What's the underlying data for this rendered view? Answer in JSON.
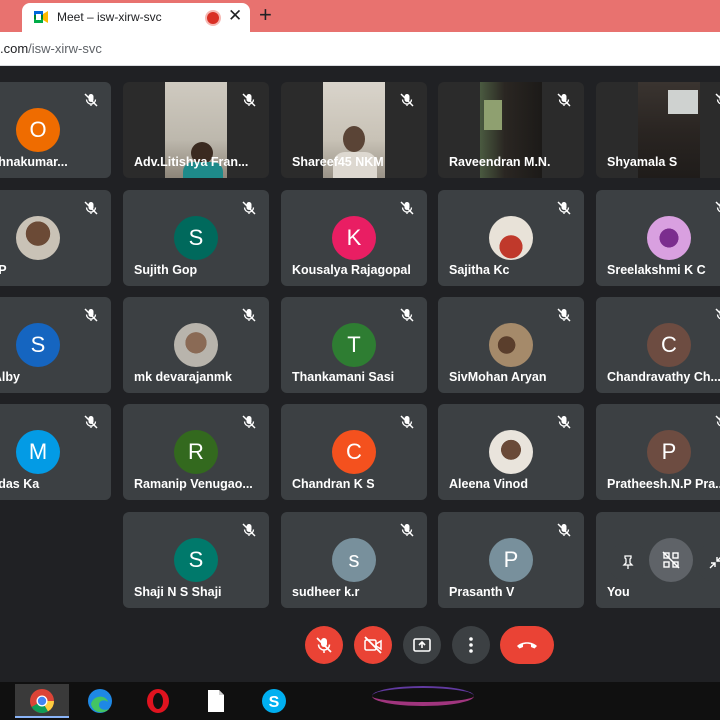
{
  "browser": {
    "tab_title": "Meet – isw-xirw-svc",
    "url_host": ".com",
    "url_path": "/isw-xirw-svc"
  },
  "participants": [
    {
      "name": "krishnakumar...",
      "initial": "O",
      "color": "#ef6c00"
    },
    {
      "name": "Adv.Litishya Fran...",
      "type": "video"
    },
    {
      "name": "Shareef45 NKM",
      "type": "video"
    },
    {
      "name": "Raveendran M.N.",
      "type": "video"
    },
    {
      "name": "Shyamala S",
      "type": "video"
    },
    {
      "name": "rali P",
      "type": "photo"
    },
    {
      "name": "Sujith Gop",
      "initial": "S",
      "color": "#00695c"
    },
    {
      "name": "Kousalya Rajagopal",
      "initial": "K",
      "color": "#e91e63"
    },
    {
      "name": "Sajitha Kc",
      "type": "photo"
    },
    {
      "name": "Sreelakshmi K C",
      "type": "photo"
    },
    {
      "name": "ija Alby",
      "initial": "S",
      "color": "#1565c0"
    },
    {
      "name": "mk devarajanmk",
      "type": "photo"
    },
    {
      "name": "Thankamani Sasi",
      "initial": "T",
      "color": "#2e7d32"
    },
    {
      "name": "SivMohan Aryan",
      "type": "photo"
    },
    {
      "name": "Chandravathy Ch...",
      "initial": "C",
      "color": "#6d4c41"
    },
    {
      "name": "handas Ka",
      "initial": "M",
      "color": "#039be5"
    },
    {
      "name": "Ramanip Venugao...",
      "initial": "R",
      "color": "#33691e"
    },
    {
      "name": "Chandran K S",
      "initial": "C",
      "color": "#f4511e"
    },
    {
      "name": "Aleena Vinod",
      "type": "photo"
    },
    {
      "name": "Pratheesh.N.P Pra...",
      "initial": "P",
      "color": "#6d4c41"
    },
    {
      "name": "Shaji N S Shaji",
      "initial": "S",
      "color": "#00796b"
    },
    {
      "name": "sudheer k.r",
      "initial": "s",
      "color": "#78909c"
    },
    {
      "name": "Prasanth V",
      "initial": "P",
      "color": "#78909c"
    },
    {
      "name": "You",
      "type": "self"
    }
  ],
  "controls": {
    "mic": "muted",
    "camera": "off",
    "present": "present-screen-icon",
    "more": "more-options-icon",
    "end": "end-call-icon"
  },
  "taskbar": [
    "chrome-icon",
    "edge-icon",
    "opera-icon",
    "file-icon",
    "skype-icon"
  ]
}
